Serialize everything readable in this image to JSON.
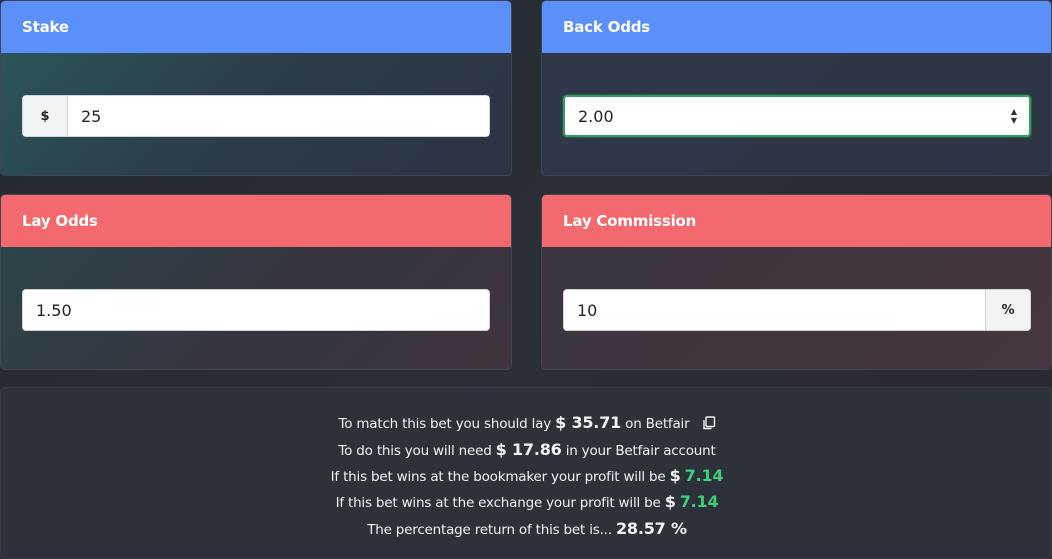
{
  "stake": {
    "title": "Stake",
    "currency": "$",
    "value": "25"
  },
  "back_odds": {
    "title": "Back Odds",
    "value": "2.00",
    "spinner_up": "▲",
    "spinner_down": "▼"
  },
  "lay_odds": {
    "title": "Lay Odds",
    "value": "1.50"
  },
  "lay_commission": {
    "title": "Lay Commission",
    "value": "10",
    "unit": "%"
  },
  "results": {
    "line1": {
      "pre": "To match this bet you should lay",
      "amount": "$ 35.71",
      "post": "on Betfair"
    },
    "line2": {
      "pre": "To do this you will need",
      "amount": "$ 17.86",
      "post": "in your Betfair account"
    },
    "line3": {
      "pre": "If this bet wins at the bookmaker your profit will be",
      "currency": "$",
      "amount": "7.14"
    },
    "line4": {
      "pre": "If this bet wins at the exchange your profit will be",
      "currency": "$",
      "amount": "7.14"
    },
    "line5": {
      "pre": "The percentage return of this bet is...",
      "amount": "28.57 %"
    }
  },
  "colors": {
    "blue_header": "#5b8ff9",
    "red_header": "#f3696d",
    "profit_green": "#3ccf7c",
    "focus_border": "#2f9e5b"
  },
  "icons": {
    "copy": "copy-icon"
  }
}
